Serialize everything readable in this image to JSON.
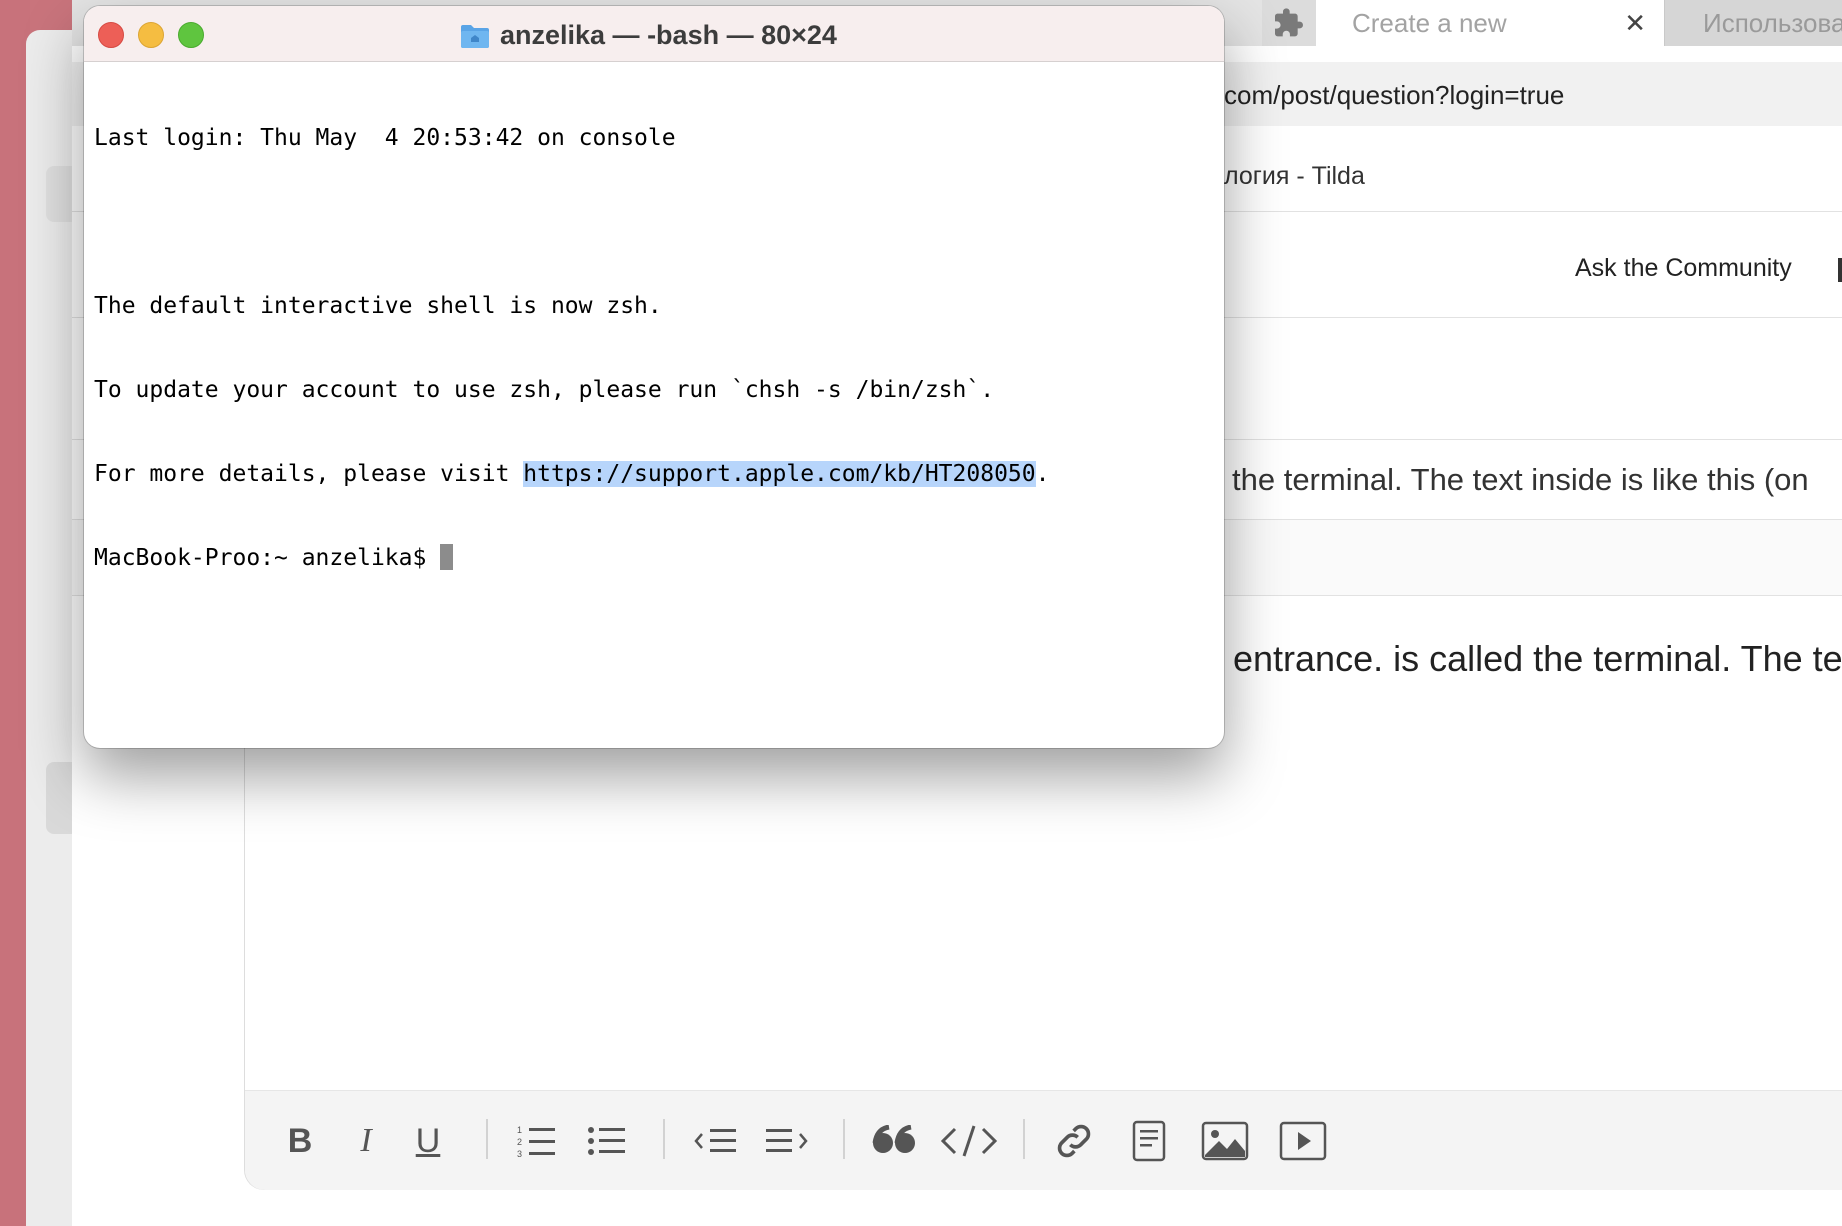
{
  "terminal": {
    "title": "anzelika — -bash — 80×24",
    "lines": [
      "Last login: Thu May  4 20:53:42 on console",
      "",
      "The default interactive shell is now zsh.",
      "To update your account to use zsh, please run `chsh -s /bin/zsh`."
    ],
    "visit_prefix": "For more details, please visit ",
    "visit_link": "https://support.apple.com/kb/HT208050",
    "visit_suffix": ".",
    "prompt": "MacBook-Proo:~ anzelika$ "
  },
  "browser": {
    "tabs": [
      {
        "label": "Create a new",
        "active": true
      },
      {
        "label": "Использовани",
        "active": false
      }
    ],
    "close_glyph": "✕",
    "url_fragment": "com/post/question?login=true",
    "bookmark_fragment": "логия - Tilda",
    "nav_link": "Ask the Community",
    "question_title_fragment": " the terminal. The text inside is like this (on",
    "body_fragment": "entrance. is called the terminal. The tex"
  },
  "editor_toolbar": {
    "bold": "B",
    "italic": "I",
    "underline": "U"
  },
  "colors": {
    "selection": "#b7d5fb",
    "close_button": "#ed5f57",
    "minimize_button": "#f5bd41",
    "zoom_button": "#5fc53f",
    "desktop": "#c8727b"
  }
}
